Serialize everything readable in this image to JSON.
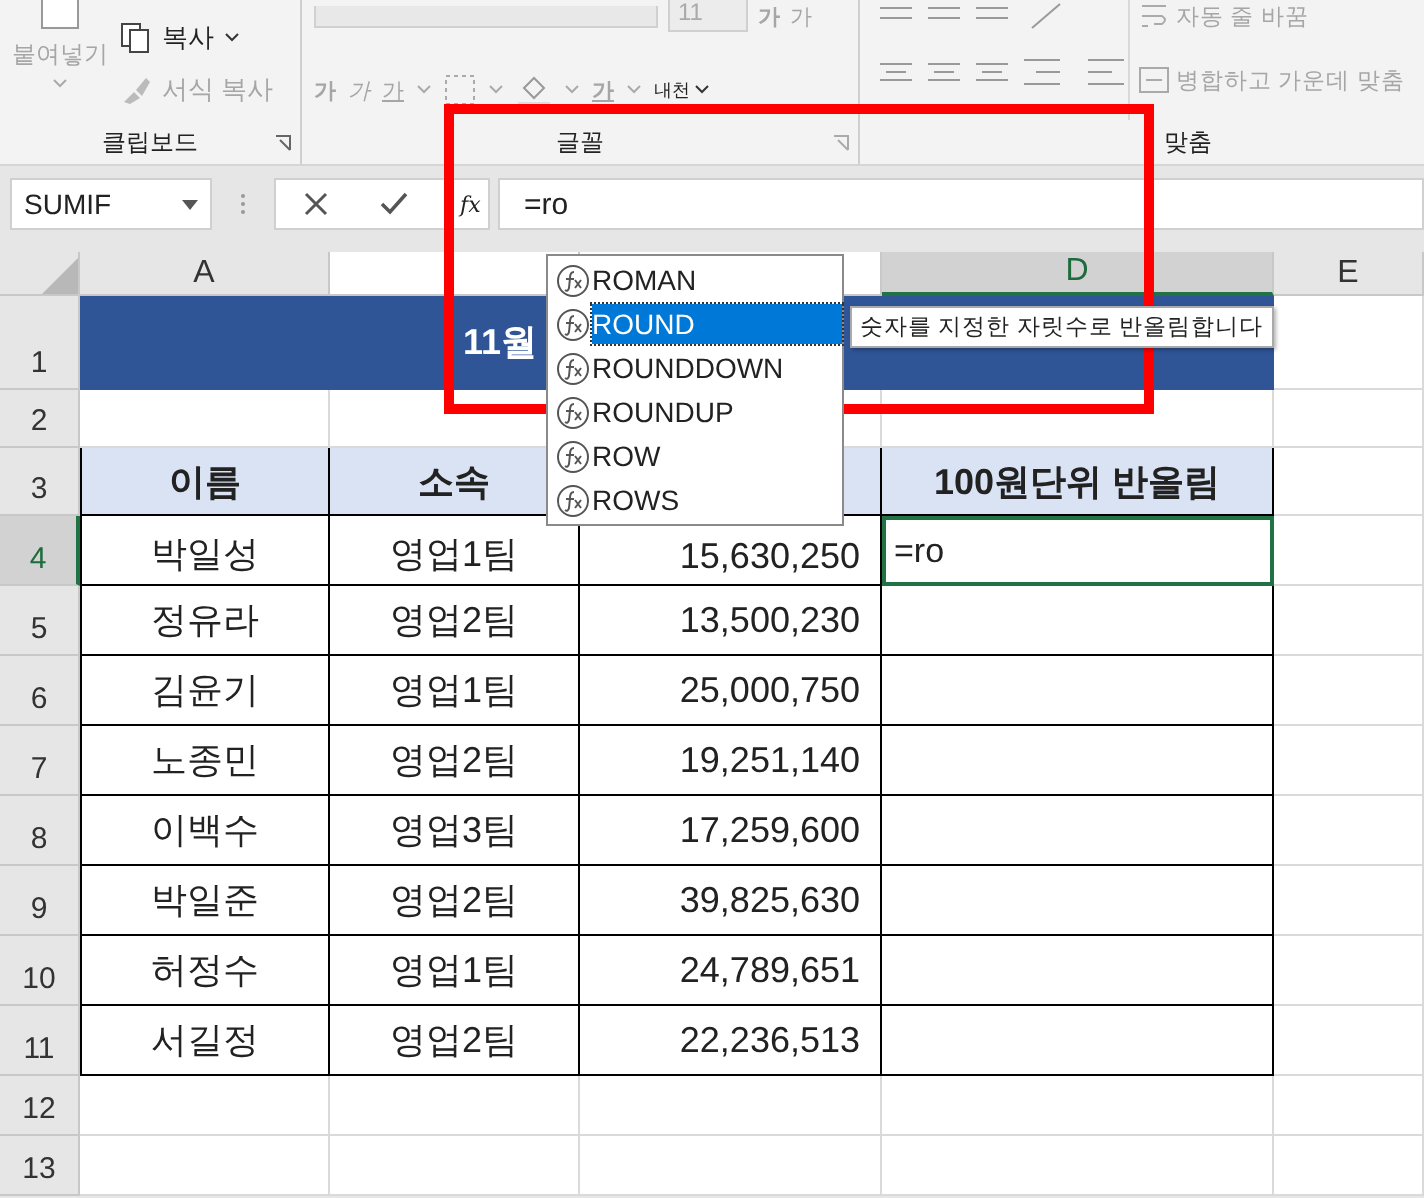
{
  "ribbon": {
    "clipboard": {
      "paste": "붙여넣기",
      "copy": "복사",
      "format_painter": "서식 복사",
      "label": "클립보드"
    },
    "font": {
      "size": "11",
      "grow": "가",
      "shrink": "가",
      "bold": "가",
      "italic": "가",
      "underline": "가",
      "font_color": "가",
      "phonetic": "내천",
      "label": "글꼴"
    },
    "alignment": {
      "wrap_text": "자동 줄 바꿈",
      "merge_center": "병합하고 가운데 맞춤",
      "label": "맞춤"
    }
  },
  "formula_bar": {
    "name_box": "SUMIF",
    "function_button": "fx",
    "value": "=ro"
  },
  "columns": [
    {
      "label": "A",
      "selected": false
    },
    {
      "selected": false
    },
    {
      "selected": false
    },
    {
      "label": "D",
      "selected": true
    },
    {
      "label": "E",
      "selected": false
    }
  ],
  "rows": [
    {
      "label": "1",
      "selected": false
    },
    {
      "label": "2",
      "selected": false
    },
    {
      "label": "3",
      "selected": false
    },
    {
      "label": "4",
      "selected": true
    },
    {
      "label": "5",
      "selected": false
    },
    {
      "label": "6",
      "selected": false
    },
    {
      "label": "7",
      "selected": false
    },
    {
      "label": "8",
      "selected": false
    },
    {
      "label": "9",
      "selected": false
    },
    {
      "label": "10",
      "selected": false
    },
    {
      "label": "11",
      "selected": false
    },
    {
      "label": "12",
      "selected": false
    },
    {
      "label": "13",
      "selected": false
    }
  ],
  "title": {
    "left": "11월"
  },
  "table": {
    "headers": [
      "이름",
      "소속",
      "100원단위 반올림"
    ],
    "rows": [
      {
        "name": "박일성",
        "team": "영업1팀",
        "amount": "15,630,250",
        "result": "=ro"
      },
      {
        "name": "정유라",
        "team": "영업2팀",
        "amount": "13,500,230"
      },
      {
        "name": "김윤기",
        "team": "영업1팀",
        "amount": "25,000,750"
      },
      {
        "name": "노종민",
        "team": "영업2팀",
        "amount": "19,251,140"
      },
      {
        "name": "이백수",
        "team": "영업3팀",
        "amount": "17,259,600"
      },
      {
        "name": "박일준",
        "team": "영업2팀",
        "amount": "39,825,630"
      },
      {
        "name": "허정수",
        "team": "영업1팀",
        "amount": "24,789,651"
      },
      {
        "name": "서길정",
        "team": "영업2팀",
        "amount": "22,236,513"
      }
    ]
  },
  "autocomplete": {
    "items": [
      {
        "label": "ROMAN",
        "selected": false
      },
      {
        "label": "ROUND",
        "selected": true
      },
      {
        "label": "ROUNDDOWN",
        "selected": false
      },
      {
        "label": "ROUNDUP",
        "selected": false
      },
      {
        "label": "ROW",
        "selected": false
      },
      {
        "label": "ROWS",
        "selected": false
      }
    ],
    "tooltip": "숫자를 지정한 자릿수로 반올림합니다"
  }
}
